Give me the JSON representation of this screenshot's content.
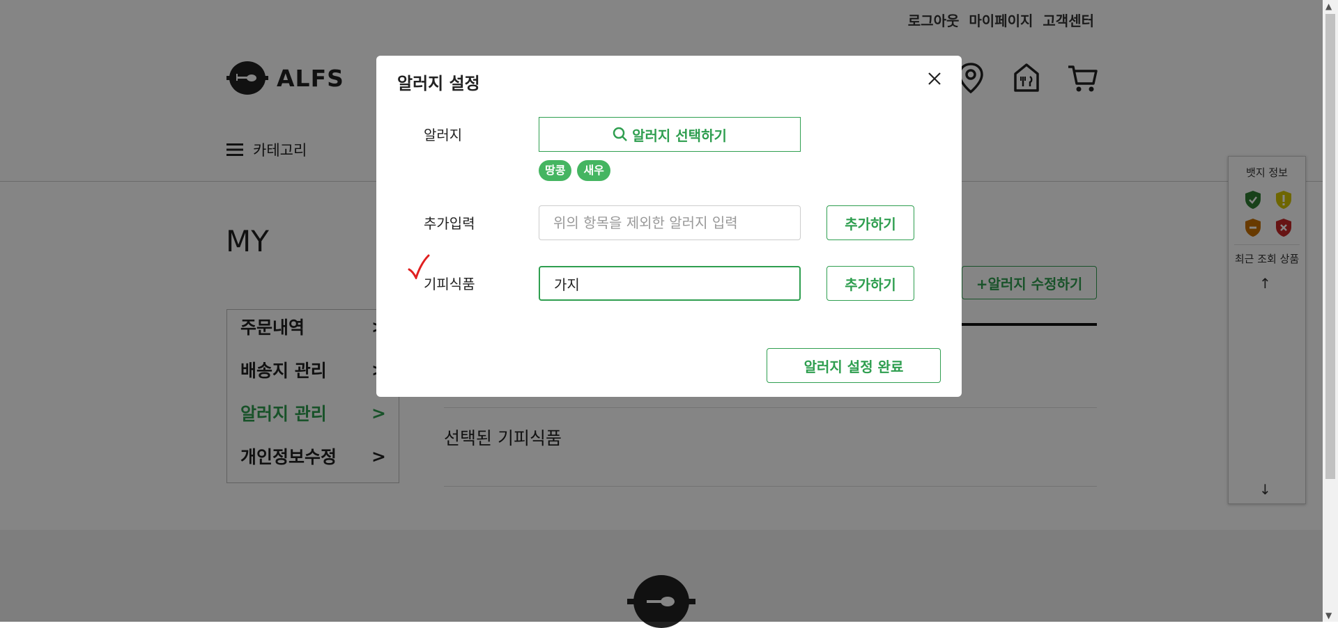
{
  "header": {
    "util_links": [
      "로그아웃",
      "마이페이지",
      "고객센터"
    ],
    "logo_text": "ALFS",
    "category_label": "카테고리",
    "icons": [
      "location-pin-icon",
      "store-icon",
      "cart-icon"
    ]
  },
  "page": {
    "title": "MY",
    "side_menu": [
      {
        "label": "주문내역",
        "active": false
      },
      {
        "label": "배송지 관리",
        "active": false
      },
      {
        "label": "알러지 관리",
        "active": true
      },
      {
        "label": "개인정보수정",
        "active": false
      }
    ],
    "edit_allergy_button": "+알러지 수정하기",
    "selected_avoid_label": "선택된 기피식품"
  },
  "badge_panel": {
    "title": "뱃지 정보",
    "badges": [
      "green-check-badge-icon",
      "yellow-exclamation-badge-icon",
      "orange-minus-badge-icon",
      "red-x-badge-icon"
    ],
    "recent_title": "최근 조회 상품",
    "up_arrow": "↑",
    "down_arrow": "↓"
  },
  "modal": {
    "title": "알러지 설정",
    "allergy_label": "알러지",
    "select_button": "알러지 선택하기",
    "tags": [
      "땅콩",
      "새우"
    ],
    "extra_label": "추가입력",
    "extra_placeholder": "위의 항목을 제외한 알러지 입력",
    "extra_value": "",
    "extra_add_button": "추가하기",
    "avoid_label": "기피식품",
    "avoid_value": "가지",
    "avoid_add_button": "추가하기",
    "done_button": "알러지 설정 완료"
  },
  "colors": {
    "brand_green": "#2e9e4f",
    "tag_green": "#45b561",
    "overlay": "rgba(0,0,0,0.48)",
    "annotation_red": "#e02020"
  }
}
